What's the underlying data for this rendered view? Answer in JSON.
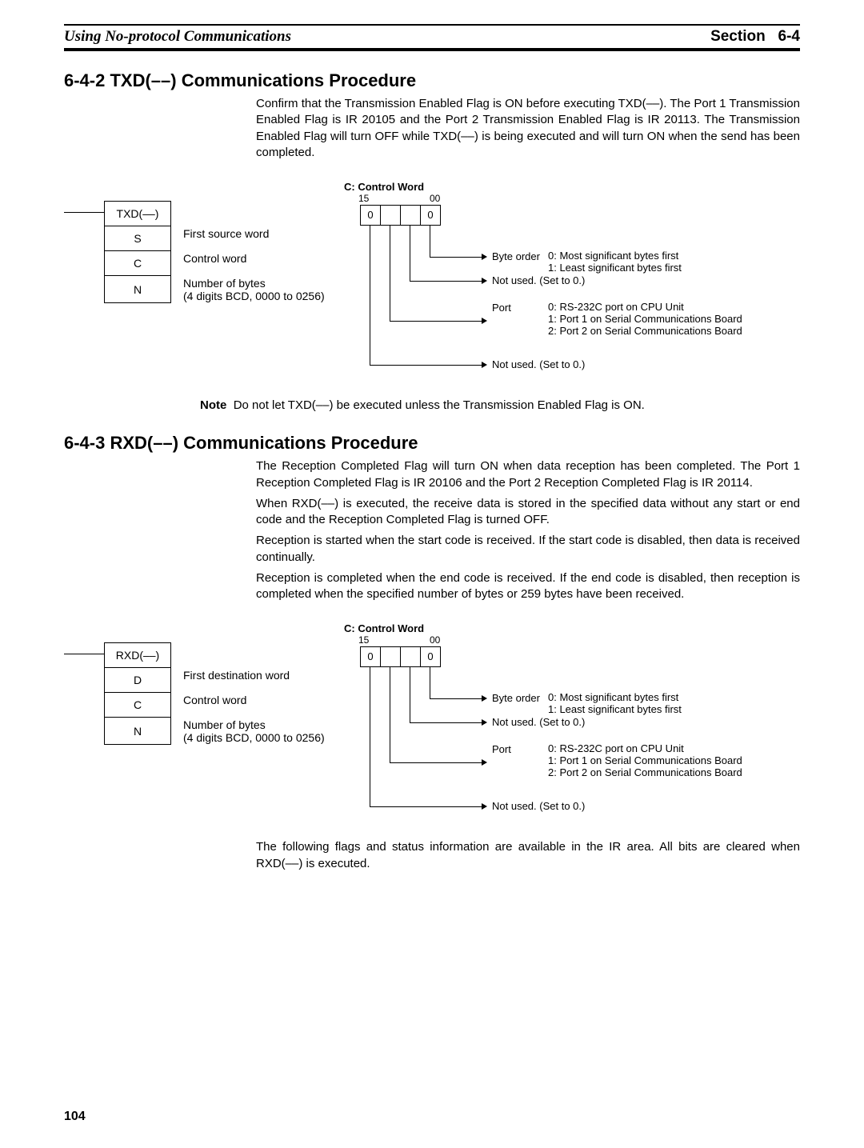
{
  "header": {
    "left": "Using No-protocol Communications",
    "section_label": "Section",
    "section_num": "6-4"
  },
  "s642": {
    "heading": "6-4-2  TXD(––) Communications Procedure",
    "p1": "Confirm that the Transmission Enabled Flag is ON before executing TXD(––). The Port 1 Transmission Enabled Flag is IR 20105 and the Port 2 Transmission Enabled Flag is IR 20113. The Transmission Enabled Flag will turn OFF while TXD(––) is being executed and will turn ON when the send has been completed.",
    "note_label": "Note",
    "note_text": "Do not let TXD(––) be executed unless the Transmission Enabled Flag is ON."
  },
  "diag_txd": {
    "c_title": "C: Control Word",
    "rows": {
      "op": "TXD(––)",
      "s": "S",
      "s_d": "First source word",
      "c": "C",
      "c_d": "Control word",
      "n": "N",
      "n_d": "Number of bytes",
      "n_d2": "(4 digits BCD, 0000 to 0256)"
    },
    "bit_hi": "15",
    "bit_lo": "00",
    "cell1": "0",
    "cell4": "0",
    "byte_order_label": "Byte order",
    "byte_order_desc": "0: Most significant bytes first\n1: Least significant bytes first",
    "not_used": "Not used. (Set to 0.)",
    "port_label": "Port",
    "port_desc": "0: RS-232C port on CPU Unit\n1: Port 1 on Serial Communications Board\n2: Port 2 on Serial Communications Board"
  },
  "s643": {
    "heading": "6-4-3  RXD(––) Communications Procedure",
    "p1": "The Reception Completed Flag will turn ON when data reception has been completed. The Port 1 Reception Completed Flag is IR 20106 and the Port 2 Reception Completed Flag is IR 20114.",
    "p2": "When RXD(––) is executed, the receive data is stored in the specified data without any start or end code and the Reception Completed Flag is turned OFF.",
    "p3": "Reception is started when the start code is received. If the start code is disabled, then data is received continually.",
    "p4": "Reception is completed when the end code is received. If the end code is disabled, then reception is completed when the specified number of bytes or 259 bytes have been received.",
    "tail": "The following flags and status information are available in the IR area. All bits are cleared when RXD(––) is executed."
  },
  "diag_rxd": {
    "c_title": "C: Control Word",
    "rows": {
      "op": "RXD(––)",
      "d": "D",
      "d_d": "First destination word",
      "c": "C",
      "c_d": "Control word",
      "n": "N",
      "n_d": "Number of bytes",
      "n_d2": "(4 digits BCD, 0000 to 0256)"
    },
    "bit_hi": "15",
    "bit_lo": "00",
    "cell1": "0",
    "cell4": "0",
    "byte_order_label": "Byte order",
    "byte_order_desc": "0: Most significant bytes first\n1: Least significant bytes first",
    "not_used": "Not used. (Set to 0.)",
    "port_label": "Port",
    "port_desc": "0: RS-232C port on CPU Unit\n1: Port 1 on Serial Communications Board\n2: Port 2 on Serial Communications Board"
  },
  "page_number": "104"
}
